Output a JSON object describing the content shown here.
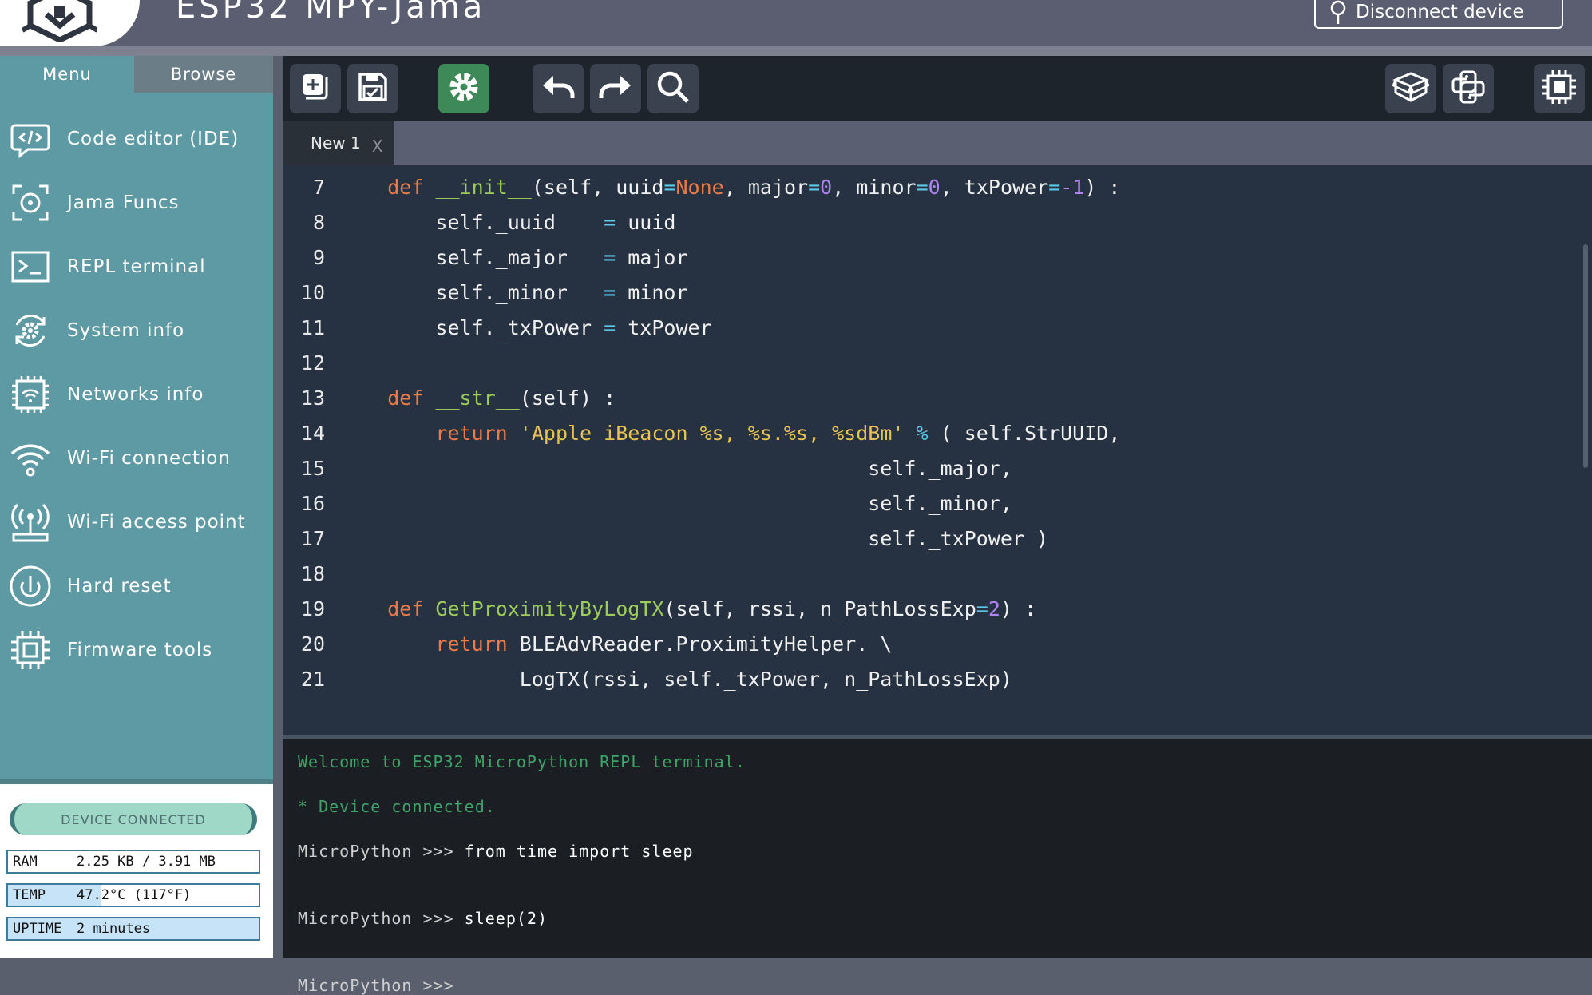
{
  "header": {
    "title": "ESP32 MPY-Jama",
    "disconnect_label": "Disconnect device"
  },
  "sidebar": {
    "tabs": [
      {
        "label": "Menu"
      },
      {
        "label": "Browse"
      }
    ],
    "items": [
      {
        "label": "Code editor (IDE)",
        "icon": "code-bubble-icon"
      },
      {
        "label": "Jama Funcs",
        "icon": "target-frame-icon"
      },
      {
        "label": "REPL terminal",
        "icon": "terminal-icon"
      },
      {
        "label": "System info",
        "icon": "gear-refresh-icon"
      },
      {
        "label": "Networks info",
        "icon": "chip-wifi-icon"
      },
      {
        "label": "Wi-Fi connection",
        "icon": "wifi-icon"
      },
      {
        "label": "Wi-Fi access point",
        "icon": "access-point-icon"
      },
      {
        "label": "Hard reset",
        "icon": "power-icon"
      },
      {
        "label": "Firmware tools",
        "icon": "chip-icon"
      }
    ],
    "status": {
      "connection": "DEVICE CONNECTED",
      "ram": {
        "key": "RAM",
        "value": "2.25 KB / 3.91 MB",
        "fraction": 0.0
      },
      "temp": {
        "key": "TEMP",
        "value": "47.2°C (117°F)",
        "fraction": 0.37
      },
      "uptime": {
        "key": "UPTIME",
        "value": "2 minutes",
        "fraction": 1.0
      }
    }
  },
  "toolbar": {
    "buttons": [
      "new-file-icon",
      "save-icon",
      "settings-icon",
      "undo-icon",
      "redo-icon",
      "search-icon",
      "package-icon",
      "python-icon",
      "chip-icon"
    ]
  },
  "editor": {
    "tab_name": "New 1",
    "tab_close": "X",
    "lines": [
      {
        "n": "7",
        "tokens": [
          [
            "",
            "    "
          ],
          [
            "kw",
            "def"
          ],
          [
            "",
            " "
          ],
          [
            "fn",
            "__init__"
          ],
          [
            "",
            "(self, uuid"
          ],
          [
            "op",
            "="
          ],
          [
            "kw",
            "None"
          ],
          [
            "",
            ", major"
          ],
          [
            "op",
            "="
          ],
          [
            "num",
            "0"
          ],
          [
            "",
            ", minor"
          ],
          [
            "op",
            "="
          ],
          [
            "num",
            "0"
          ],
          [
            "",
            ", txPower"
          ],
          [
            "op",
            "="
          ],
          [
            "num",
            "-1"
          ],
          [
            "",
            ") :"
          ]
        ]
      },
      {
        "n": "8",
        "tokens": [
          [
            "",
            "        self._uuid    "
          ],
          [
            "op",
            "="
          ],
          [
            "",
            " uuid"
          ]
        ]
      },
      {
        "n": "9",
        "tokens": [
          [
            "",
            "        self._major   "
          ],
          [
            "op",
            "="
          ],
          [
            "",
            " major"
          ]
        ]
      },
      {
        "n": "10",
        "tokens": [
          [
            "",
            "        self._minor   "
          ],
          [
            "op",
            "="
          ],
          [
            "",
            " minor"
          ]
        ]
      },
      {
        "n": "11",
        "tokens": [
          [
            "",
            "        self._txPower "
          ],
          [
            "op",
            "="
          ],
          [
            "",
            " txPower"
          ]
        ]
      },
      {
        "n": "12",
        "tokens": []
      },
      {
        "n": "13",
        "tokens": [
          [
            "",
            "    "
          ],
          [
            "kw",
            "def"
          ],
          [
            "",
            " "
          ],
          [
            "fn",
            "__str__"
          ],
          [
            "",
            "(self) :"
          ]
        ]
      },
      {
        "n": "14",
        "tokens": [
          [
            "",
            "        "
          ],
          [
            "kw",
            "return"
          ],
          [
            "",
            " "
          ],
          [
            "str",
            "'Apple iBeacon %s, %s.%s, %sdBm'"
          ],
          [
            "",
            " "
          ],
          [
            "op",
            "%"
          ],
          [
            "",
            " ( self.StrUUID,"
          ]
        ]
      },
      {
        "n": "15",
        "tokens": [
          [
            "",
            "                                            self._major,"
          ]
        ]
      },
      {
        "n": "16",
        "tokens": [
          [
            "",
            "                                            self._minor,"
          ]
        ]
      },
      {
        "n": "17",
        "tokens": [
          [
            "",
            "                                            self._txPower )"
          ]
        ]
      },
      {
        "n": "18",
        "tokens": []
      },
      {
        "n": "19",
        "tokens": [
          [
            "",
            "    "
          ],
          [
            "kw",
            "def"
          ],
          [
            "",
            " "
          ],
          [
            "fn",
            "GetProximityByLogTX"
          ],
          [
            "",
            "(self, rssi, n_PathLossExp"
          ],
          [
            "op",
            "="
          ],
          [
            "num",
            "2"
          ],
          [
            "",
            ") :"
          ]
        ]
      },
      {
        "n": "20",
        "tokens": [
          [
            "",
            "        "
          ],
          [
            "kw",
            "return"
          ],
          [
            "",
            " BLEAdvReader.ProximityHelper. \\"
          ]
        ]
      },
      {
        "n": "21",
        "tokens": [
          [
            "",
            "               LogTX(rssi, self._txPower, n_PathLossExp)"
          ]
        ]
      }
    ]
  },
  "terminal": {
    "welcome": "Welcome to ESP32 MicroPython REPL terminal.",
    "connected": "* Device connected.",
    "prompt": "MicroPython >>>",
    "commands": [
      "from time import sleep",
      "sleep(2)",
      ""
    ]
  }
}
